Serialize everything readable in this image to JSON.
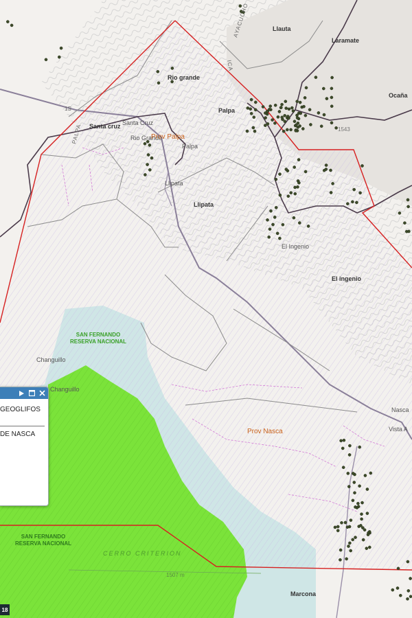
{
  "map": {
    "region_labels": {
      "prov_palpa": "Prov Palpa",
      "prov_nasca": "Prov Nasca",
      "reserve_top_1": "SAN FERNANDO",
      "reserve_top_2": "RESERVA NACIONAL",
      "reserve_bottom_1": "SAN FERNANDO",
      "reserve_bottom_2": "RESERVA NACIONAL"
    },
    "place_labels": {
      "llauta": "Llauta",
      "laramate": "Laramate",
      "ocana": "Ocaña",
      "rio_grande": "Rio grande",
      "palpa": "Palpa",
      "palpa_town": "Palpa",
      "santa_cruz": "Santa cruz",
      "santa_cruz_town": "Santa Cruz",
      "rio_grande_town": "Rio Grande",
      "llipata": "Llipata",
      "llipata_town": "Llipata",
      "el_ingenio": "El ingenio",
      "el_ingenio_town": "El Ingenio",
      "changuillo": "Changuillo",
      "changuillo_2": "Changuillo",
      "nasca": "Nasca",
      "vista_alegre": "Vista A",
      "marcona": "Marcona",
      "cerro_criterion": "CERRO CRITERION",
      "ayacucho": "AYACUCHO",
      "ica": "ICA",
      "palpa_vertical": "PALPA",
      "elev_1543": "1543",
      "elev_1507": "1507 m",
      "road_1s": "1S"
    }
  },
  "popup": {
    "title": "GEOGLIFOS",
    "text": "DE NASCA"
  },
  "badge": {
    "text": "18"
  },
  "colors": {
    "study_boundary": "#d62020",
    "province_boundary": "#4a3a4a",
    "reserve_green": "#7be33a",
    "sea_blue": "#cfe6e6",
    "geoglyph_point": "#3d4a2a",
    "popup_header": "#3d7fb8"
  },
  "icons": [
    "play-icon",
    "maximize-icon",
    "close-icon"
  ]
}
